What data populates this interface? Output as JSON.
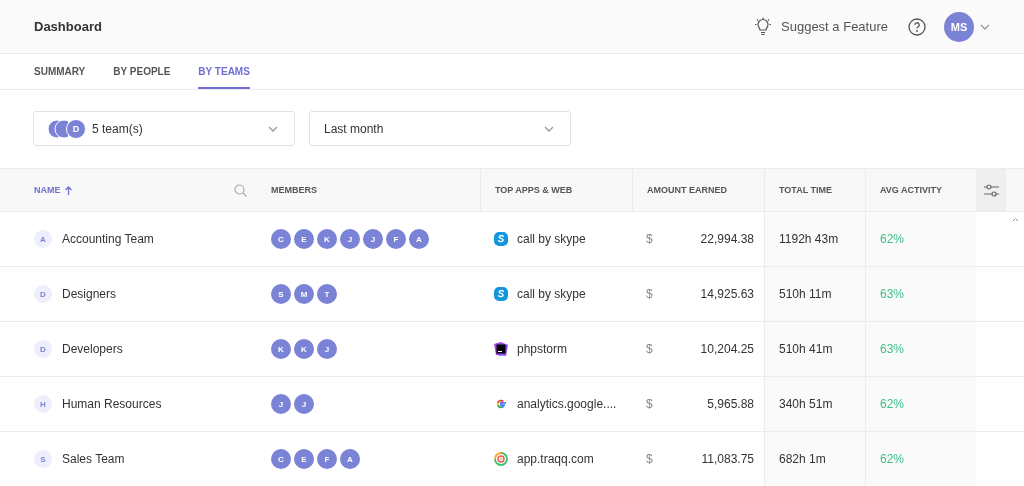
{
  "header": {
    "title": "Dashboard",
    "suggest": "Suggest a Feature",
    "user_initials": "MS"
  },
  "tabs": [
    {
      "label": "SUMMARY",
      "selected": false
    },
    {
      "label": "BY PEOPLE",
      "selected": false
    },
    {
      "label": "BY TEAMS",
      "selected": true
    }
  ],
  "filters": {
    "teams": {
      "front_initial": "D",
      "value": "5 team(s)"
    },
    "period": {
      "value": "Last month"
    }
  },
  "table": {
    "columns": [
      {
        "label": "NAME",
        "sorted": true
      },
      {
        "label": "MEMBERS",
        "sorted": false
      },
      {
        "label": "TOP APPS & WEB",
        "sorted": false
      },
      {
        "label": "AMOUNT EARNED",
        "sorted": false
      },
      {
        "label": "TOTAL TIME",
        "sorted": false
      },
      {
        "label": "AVG ACTIVITY",
        "sorted": false
      }
    ],
    "rows": [
      {
        "initial": "A",
        "name": "Accounting Team",
        "members": [
          "C",
          "E",
          "K",
          "J",
          "J",
          "F",
          "A"
        ],
        "app": {
          "kind": "skype",
          "name": "call by skype"
        },
        "currency": "$",
        "amount": "22,994.38",
        "total_time": "1192h 43m",
        "activity": "62%"
      },
      {
        "initial": "D",
        "name": "Designers",
        "members": [
          "S",
          "M",
          "T"
        ],
        "app": {
          "kind": "skype",
          "name": "call by skype"
        },
        "currency": "$",
        "amount": "14,925.63",
        "total_time": "510h 11m",
        "activity": "63%"
      },
      {
        "initial": "D",
        "name": "Developers",
        "members": [
          "K",
          "K",
          "J"
        ],
        "app": {
          "kind": "phpstorm",
          "name": "phpstorm"
        },
        "currency": "$",
        "amount": "10,204.25",
        "total_time": "510h 41m",
        "activity": "63%"
      },
      {
        "initial": "H",
        "name": "Human Resources",
        "members": [
          "J",
          "J"
        ],
        "app": {
          "kind": "google",
          "name": "analytics.google...."
        },
        "currency": "$",
        "amount": "5,965.88",
        "total_time": "340h 51m",
        "activity": "62%"
      },
      {
        "initial": "S",
        "name": "Sales Team",
        "members": [
          "C",
          "E",
          "F",
          "A"
        ],
        "app": {
          "kind": "traqq",
          "name": "app.traqq.com"
        },
        "currency": "$",
        "amount": "11,083.75",
        "total_time": "682h 1m",
        "activity": "62%"
      }
    ]
  }
}
